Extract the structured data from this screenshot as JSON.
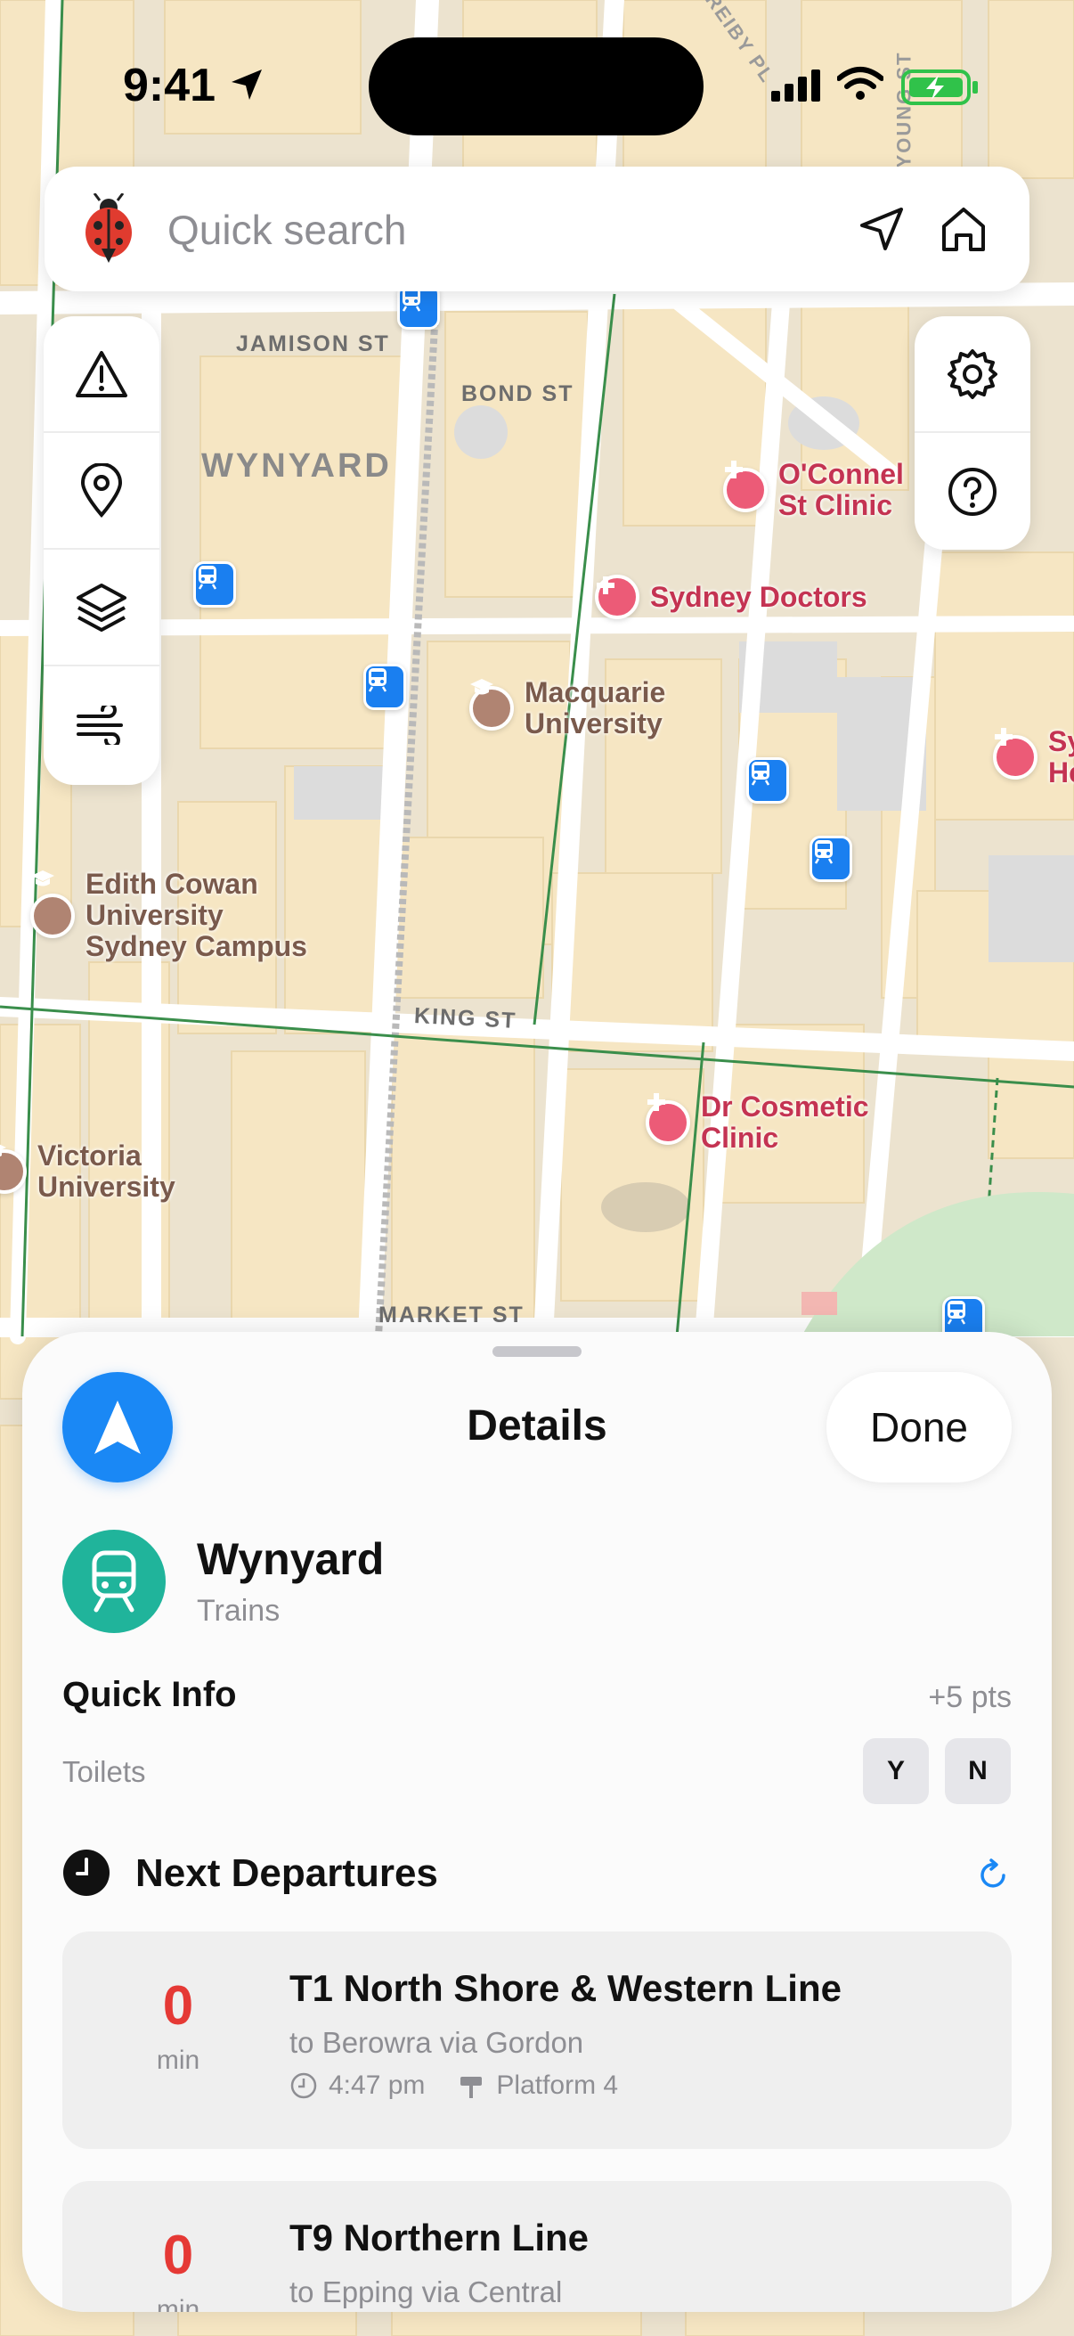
{
  "status_bar": {
    "time": "9:41"
  },
  "search": {
    "placeholder": "Quick search"
  },
  "map": {
    "streets": [
      "JAMISON ST",
      "BOND ST",
      "KING ST",
      "MARKET ST",
      "REIBY PL",
      "YOUNG ST"
    ],
    "district": "WYNYARD",
    "pois": [
      {
        "name": "O'Connell St Clinic",
        "line1": "O'Connel",
        "line2": "St Clinic",
        "kind": "medical"
      },
      {
        "name": "Sydney Doctors",
        "kind": "medical"
      },
      {
        "name": "Macquarie University",
        "line1": "Macquarie",
        "line2": "University",
        "kind": "university"
      },
      {
        "name": "Edith Cowan University Sydney Campus",
        "line1": "Edith Cowan",
        "line2": "University",
        "line3": "Sydney Campus",
        "kind": "university"
      },
      {
        "name": "Dr Cosmetic Clinic",
        "line1": "Dr Cosmetic",
        "line2": "Clinic",
        "kind": "medical"
      },
      {
        "name": "Victoria University",
        "line1": "Victoria",
        "line2": "University",
        "kind": "university"
      },
      {
        "name": "Sy He",
        "line1": "Sy",
        "line2": "He",
        "kind": "medical"
      }
    ]
  },
  "sheet": {
    "title": "Details",
    "done_label": "Done",
    "station": {
      "name": "Wynyard",
      "type": "Trains"
    },
    "quick_info": {
      "title": "Quick Info",
      "points": "+5 pts",
      "toilets_label": "Toilets",
      "yes": "Y",
      "no": "N"
    },
    "departures": {
      "title": "Next Departures",
      "items": [
        {
          "minutes": "0",
          "unit": "min",
          "line": "T1 North Shore & Western Line",
          "destination": "to Berowra via Gordon",
          "time": "4:47 pm",
          "platform": "Platform 4"
        },
        {
          "minutes": "0",
          "unit": "min",
          "line": "T9 Northern Line",
          "destination": "to Epping via Central"
        }
      ]
    }
  },
  "colors": {
    "accent": "#1a88f5",
    "train": "#20b49b",
    "urgent": "#e53935",
    "medical": "#ec5b77"
  }
}
